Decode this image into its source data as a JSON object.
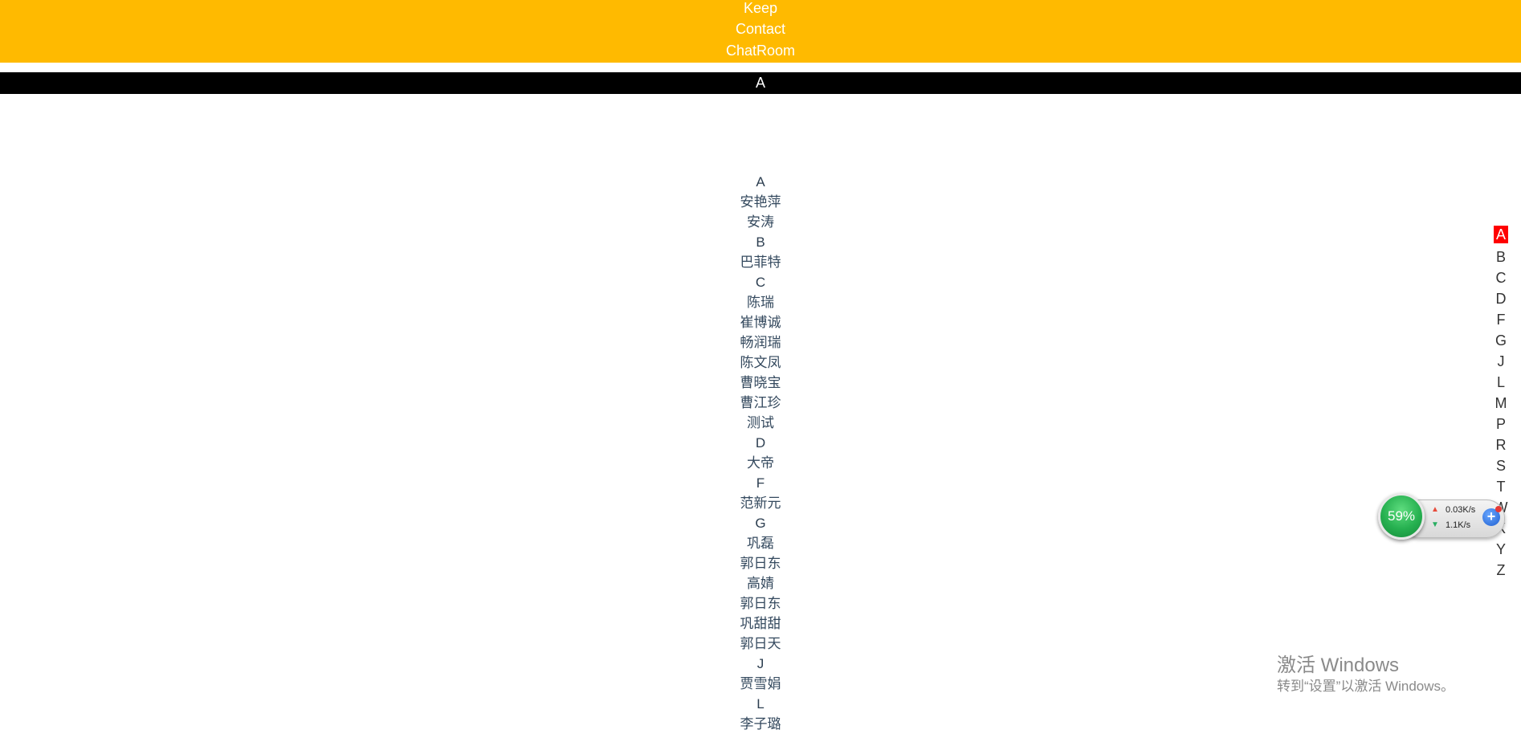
{
  "nav": {
    "items": [
      "Keep",
      "Contact",
      "ChatRoom"
    ]
  },
  "section_bar": {
    "label": "A"
  },
  "contacts": {
    "rows": [
      {
        "type": "header",
        "text": "A"
      },
      {
        "type": "contact",
        "text": "安艳萍"
      },
      {
        "type": "contact",
        "text": "安涛"
      },
      {
        "type": "header",
        "text": "B"
      },
      {
        "type": "contact",
        "text": "巴菲特"
      },
      {
        "type": "header",
        "text": "C"
      },
      {
        "type": "contact",
        "text": "陈瑞"
      },
      {
        "type": "contact",
        "text": "崔博诚"
      },
      {
        "type": "contact",
        "text": "畅润瑞"
      },
      {
        "type": "contact",
        "text": "陈文凤"
      },
      {
        "type": "contact",
        "text": "曹晓宝"
      },
      {
        "type": "contact",
        "text": "曹江珍"
      },
      {
        "type": "contact",
        "text": "测试"
      },
      {
        "type": "header",
        "text": "D"
      },
      {
        "type": "contact",
        "text": "大帝"
      },
      {
        "type": "header",
        "text": "F"
      },
      {
        "type": "contact",
        "text": "范新元"
      },
      {
        "type": "header",
        "text": "G"
      },
      {
        "type": "contact",
        "text": "巩磊"
      },
      {
        "type": "contact",
        "text": "郭日东"
      },
      {
        "type": "contact",
        "text": "高婧"
      },
      {
        "type": "contact",
        "text": "郭日东"
      },
      {
        "type": "contact",
        "text": "巩甜甜"
      },
      {
        "type": "contact",
        "text": "郭日天"
      },
      {
        "type": "header",
        "text": "J"
      },
      {
        "type": "contact",
        "text": "贾雪娟"
      },
      {
        "type": "header",
        "text": "L"
      },
      {
        "type": "contact",
        "text": "李子璐"
      }
    ]
  },
  "index_bar": {
    "letters": [
      "A",
      "B",
      "C",
      "D",
      "F",
      "G",
      "J",
      "L",
      "M",
      "P",
      "R",
      "S",
      "T",
      "W",
      "X",
      "Y",
      "Z"
    ],
    "active": "A",
    "active_color": "#ff0000"
  },
  "net_widget": {
    "percent": "59%",
    "upload": "0.03K/s",
    "download": "1.1K/s"
  },
  "watermark": {
    "line1": "激活 Windows",
    "line2": "转到“设置”以激活 Windows。"
  },
  "colors": {
    "nav_bg": "#ffba00",
    "section_bar_bg": "#000000"
  }
}
